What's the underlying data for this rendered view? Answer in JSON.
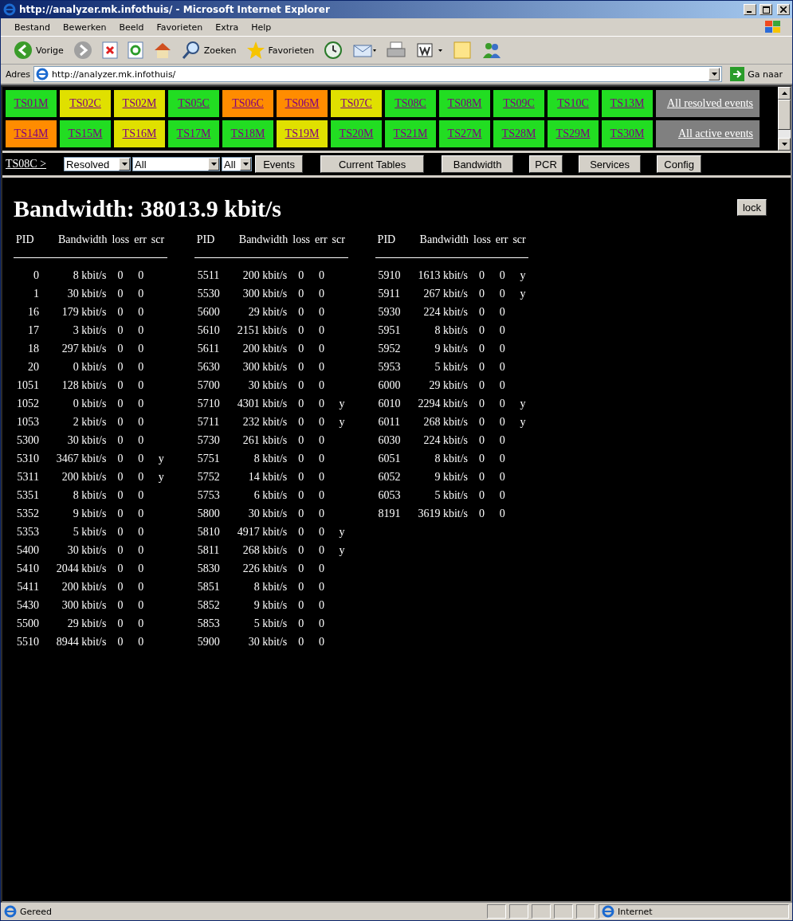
{
  "window": {
    "title": "http://analyzer.mk.infothuis/ - Microsoft Internet Explorer"
  },
  "menu": [
    "Bestand",
    "Bewerken",
    "Beeld",
    "Favorieten",
    "Extra",
    "Help"
  ],
  "toolbar": [
    {
      "kind": "back",
      "label": "Vorige"
    },
    {
      "kind": "forward"
    },
    {
      "kind": "stop"
    },
    {
      "kind": "refresh"
    },
    {
      "kind": "home"
    },
    {
      "kind": "search",
      "label": "Zoeken"
    },
    {
      "kind": "favorites",
      "label": "Favorieten"
    },
    {
      "kind": "history"
    },
    {
      "kind": "mail"
    },
    {
      "kind": "print"
    },
    {
      "kind": "edit"
    },
    {
      "kind": "note"
    },
    {
      "kind": "messenger"
    }
  ],
  "address": {
    "label": "Adres",
    "value": "http://analyzer.mk.infothuis/",
    "go": "Ga naar"
  },
  "streams": [
    [
      {
        "label": "TS01M",
        "color": "#22dd22"
      },
      {
        "label": "TS02C",
        "color": "#e0e000"
      },
      {
        "label": "TS02M",
        "color": "#e0e000"
      },
      {
        "label": "TS05C",
        "color": "#22dd22"
      },
      {
        "label": "TS06C",
        "color": "#ff8c00"
      },
      {
        "label": "TS06M",
        "color": "#ff8c00"
      },
      {
        "label": "TS07C",
        "color": "#e0e000"
      },
      {
        "label": "TS08C",
        "color": "#22dd22"
      },
      {
        "label": "TS08M",
        "color": "#22dd22"
      },
      {
        "label": "TS09C",
        "color": "#22dd22"
      },
      {
        "label": "TS10C",
        "color": "#22dd22"
      },
      {
        "label": "TS13M",
        "color": "#22dd22"
      },
      {
        "label": "All resolved events",
        "color": "#808080"
      }
    ],
    [
      {
        "label": "TS14M",
        "color": "#ff8c00"
      },
      {
        "label": "TS15M",
        "color": "#22dd22"
      },
      {
        "label": "TS16M",
        "color": "#e0e000"
      },
      {
        "label": "TS17M",
        "color": "#22dd22"
      },
      {
        "label": "TS18M",
        "color": "#22dd22"
      },
      {
        "label": "TS19M",
        "color": "#e0e000"
      },
      {
        "label": "TS20M",
        "color": "#22dd22"
      },
      {
        "label": "TS21M",
        "color": "#22dd22"
      },
      {
        "label": "TS27M",
        "color": "#22dd22"
      },
      {
        "label": "TS28M",
        "color": "#22dd22"
      },
      {
        "label": "TS29M",
        "color": "#22dd22"
      },
      {
        "label": "TS30M",
        "color": "#22dd22"
      },
      {
        "label": "All active events",
        "color": "#808080"
      }
    ]
  ],
  "nav": {
    "current": "TS08C >",
    "selects": [
      "Resolved",
      "All",
      "All"
    ],
    "buttons": [
      "Events",
      "Current Tables",
      "Bandwidth",
      "PCR",
      "Services",
      "Config"
    ]
  },
  "title": "Bandwidth: 38013.9 kbit/s",
  "lock": "lock",
  "columns": [
    [
      "PID",
      "Bandwidth",
      "loss",
      "err",
      "scr"
    ],
    [
      "PID",
      "Bandwidth",
      "loss",
      "err",
      "scr"
    ],
    [
      "PID",
      "Bandwidth",
      "loss",
      "err",
      "scr"
    ]
  ],
  "tables": [
    [
      {
        "pid": "0",
        "bw": "8 kbit/s",
        "loss": "0",
        "err": "0"
      },
      {
        "pid": "1",
        "bw": "30 kbit/s",
        "loss": "0",
        "err": "0"
      },
      {
        "pid": "16",
        "bw": "179 kbit/s",
        "loss": "0",
        "err": "0"
      },
      {
        "pid": "17",
        "bw": "3 kbit/s",
        "loss": "0",
        "err": "0"
      },
      {
        "pid": "18",
        "bw": "297 kbit/s",
        "loss": "0",
        "err": "0"
      },
      {
        "pid": "20",
        "bw": "0 kbit/s",
        "loss": "0",
        "err": "0"
      },
      {
        "pid": "1051",
        "bw": "128 kbit/s",
        "loss": "0",
        "err": "0"
      },
      {
        "pid": "1052",
        "bw": "0 kbit/s",
        "loss": "0",
        "err": "0"
      },
      {
        "pid": "1053",
        "bw": "2 kbit/s",
        "loss": "0",
        "err": "0"
      },
      {
        "pid": "5300",
        "bw": "30 kbit/s",
        "loss": "0",
        "err": "0"
      },
      {
        "pid": "5310",
        "bw": "3467 kbit/s",
        "loss": "0",
        "err": "0",
        "scr": "y"
      },
      {
        "pid": "5311",
        "bw": "200 kbit/s",
        "loss": "0",
        "err": "0",
        "scr": "y"
      },
      {
        "pid": "5351",
        "bw": "8 kbit/s",
        "loss": "0",
        "err": "0"
      },
      {
        "pid": "5352",
        "bw": "9 kbit/s",
        "loss": "0",
        "err": "0"
      },
      {
        "pid": "5353",
        "bw": "5 kbit/s",
        "loss": "0",
        "err": "0"
      },
      {
        "pid": "5400",
        "bw": "30 kbit/s",
        "loss": "0",
        "err": "0"
      },
      {
        "pid": "5410",
        "bw": "2044 kbit/s",
        "loss": "0",
        "err": "0"
      },
      {
        "pid": "5411",
        "bw": "200 kbit/s",
        "loss": "0",
        "err": "0"
      },
      {
        "pid": "5430",
        "bw": "300 kbit/s",
        "loss": "0",
        "err": "0"
      },
      {
        "pid": "5500",
        "bw": "29 kbit/s",
        "loss": "0",
        "err": "0"
      },
      {
        "pid": "5510",
        "bw": "8944 kbit/s",
        "loss": "0",
        "err": "0"
      }
    ],
    [
      {
        "pid": "5511",
        "bw": "200 kbit/s",
        "loss": "0",
        "err": "0"
      },
      {
        "pid": "5530",
        "bw": "300 kbit/s",
        "loss": "0",
        "err": "0"
      },
      {
        "pid": "5600",
        "bw": "29 kbit/s",
        "loss": "0",
        "err": "0"
      },
      {
        "pid": "5610",
        "bw": "2151 kbit/s",
        "loss": "0",
        "err": "0"
      },
      {
        "pid": "5611",
        "bw": "200 kbit/s",
        "loss": "0",
        "err": "0"
      },
      {
        "pid": "5630",
        "bw": "300 kbit/s",
        "loss": "0",
        "err": "0"
      },
      {
        "pid": "5700",
        "bw": "30 kbit/s",
        "loss": "0",
        "err": "0"
      },
      {
        "pid": "5710",
        "bw": "4301 kbit/s",
        "loss": "0",
        "err": "0",
        "scr": "y"
      },
      {
        "pid": "5711",
        "bw": "232 kbit/s",
        "loss": "0",
        "err": "0",
        "scr": "y"
      },
      {
        "pid": "5730",
        "bw": "261 kbit/s",
        "loss": "0",
        "err": "0"
      },
      {
        "pid": "5751",
        "bw": "8 kbit/s",
        "loss": "0",
        "err": "0"
      },
      {
        "pid": "5752",
        "bw": "14 kbit/s",
        "loss": "0",
        "err": "0"
      },
      {
        "pid": "5753",
        "bw": "6 kbit/s",
        "loss": "0",
        "err": "0"
      },
      {
        "pid": "5800",
        "bw": "30 kbit/s",
        "loss": "0",
        "err": "0"
      },
      {
        "pid": "5810",
        "bw": "4917 kbit/s",
        "loss": "0",
        "err": "0",
        "scr": "y"
      },
      {
        "pid": "5811",
        "bw": "268 kbit/s",
        "loss": "0",
        "err": "0",
        "scr": "y"
      },
      {
        "pid": "5830",
        "bw": "226 kbit/s",
        "loss": "0",
        "err": "0"
      },
      {
        "pid": "5851",
        "bw": "8 kbit/s",
        "loss": "0",
        "err": "0"
      },
      {
        "pid": "5852",
        "bw": "9 kbit/s",
        "loss": "0",
        "err": "0"
      },
      {
        "pid": "5853",
        "bw": "5 kbit/s",
        "loss": "0",
        "err": "0"
      },
      {
        "pid": "5900",
        "bw": "30 kbit/s",
        "loss": "0",
        "err": "0"
      }
    ],
    [
      {
        "pid": "5910",
        "bw": "1613 kbit/s",
        "loss": "0",
        "err": "0",
        "scr": "y"
      },
      {
        "pid": "5911",
        "bw": "267 kbit/s",
        "loss": "0",
        "err": "0",
        "scr": "y"
      },
      {
        "pid": "5930",
        "bw": "224 kbit/s",
        "loss": "0",
        "err": "0"
      },
      {
        "pid": "5951",
        "bw": "8 kbit/s",
        "loss": "0",
        "err": "0"
      },
      {
        "pid": "5952",
        "bw": "9 kbit/s",
        "loss": "0",
        "err": "0"
      },
      {
        "pid": "5953",
        "bw": "5 kbit/s",
        "loss": "0",
        "err": "0"
      },
      {
        "pid": "6000",
        "bw": "29 kbit/s",
        "loss": "0",
        "err": "0"
      },
      {
        "pid": "6010",
        "bw": "2294 kbit/s",
        "loss": "0",
        "err": "0",
        "scr": "y"
      },
      {
        "pid": "6011",
        "bw": "268 kbit/s",
        "loss": "0",
        "err": "0",
        "scr": "y"
      },
      {
        "pid": "6030",
        "bw": "224 kbit/s",
        "loss": "0",
        "err": "0"
      },
      {
        "pid": "6051",
        "bw": "8 kbit/s",
        "loss": "0",
        "err": "0"
      },
      {
        "pid": "6052",
        "bw": "9 kbit/s",
        "loss": "0",
        "err": "0"
      },
      {
        "pid": "6053",
        "bw": "5 kbit/s",
        "loss": "0",
        "err": "0"
      },
      {
        "pid": "8191",
        "bw": "3619 kbit/s",
        "loss": "0",
        "err": "0"
      }
    ]
  ],
  "status": {
    "text": "Gereed",
    "zone": "Internet"
  }
}
